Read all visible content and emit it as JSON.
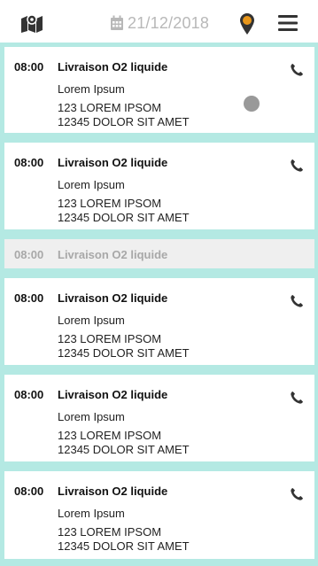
{
  "header": {
    "date": "21/12/2018",
    "map_icon": "map-icon",
    "calendar_icon": "calendar-icon",
    "pin_icon": "location-pin-icon",
    "menu_icon": "menu-icon"
  },
  "colors": {
    "list_background": "#b4e9e3",
    "pin_accent": "#e8961a",
    "icon_dark": "#333333",
    "muted_text": "#a8a8a8"
  },
  "deliveries": [
    {
      "time": "08:00",
      "title": "Livraison O2 liquide",
      "subtitle": "Lorem Ipsum",
      "address_line1": "123 LOREM IPSOM",
      "address_line2": "12345 DOLOR SIT AMET",
      "phone_icon": "phone-icon"
    },
    {
      "time": "08:00",
      "title": "Livraison O2 liquide",
      "subtitle": "Lorem Ipsum",
      "address_line1": "123 LOREM IPSOM",
      "address_line2": "12345 DOLOR SIT AMET",
      "phone_icon": "phone-icon"
    },
    {
      "time": "08:00",
      "title": "Livraison O2 liquide",
      "subtitle": "Lorem Ipsum",
      "address_line1": "123 LOREM IPSOM",
      "address_line2": "12345 DOLOR SIT AMET",
      "phone_icon": "phone-icon"
    },
    {
      "time": "08:00",
      "title": "Livraison O2 liquide",
      "subtitle": "Lorem Ipsum",
      "address_line1": "123 LOREM IPSOM",
      "address_line2": "12345 DOLOR SIT AMET",
      "phone_icon": "phone-icon"
    },
    {
      "time": "08:00",
      "title": "Livraison O2 liquide",
      "subtitle": "Lorem Ipsum",
      "address_line1": "123 LOREM IPSOM",
      "address_line2": "12345 DOLOR SIT AMET",
      "phone_icon": "phone-icon"
    }
  ],
  "collapsed_row": {
    "time": "08:00",
    "title": "Livraison O2 liquide"
  }
}
